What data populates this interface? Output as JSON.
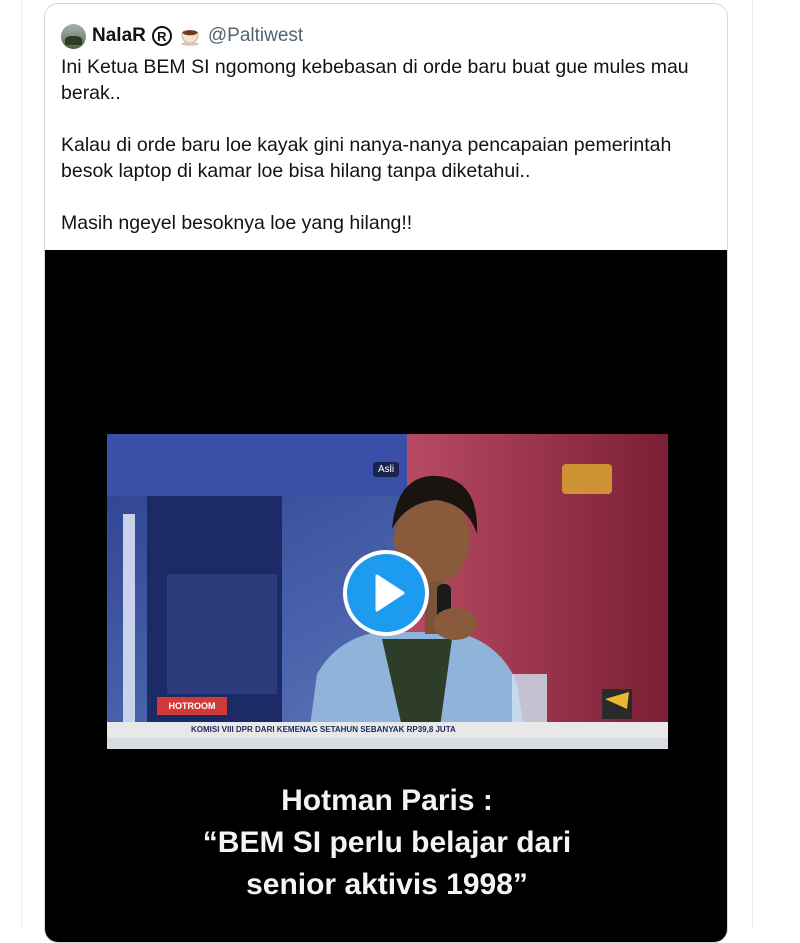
{
  "tweet": {
    "display_name": "NalaR",
    "badge": "R",
    "emoji_icon": "coffee-cup-icon",
    "handle": "@Paltiwest",
    "paragraphs": [
      "Ini Ketua BEM SI ngomong kebebasan di orde baru buat gue mules mau berak..",
      "Kalau di orde baru loe kayak gini nanya-nanya pencapaian pemerintah besok laptop di kamar loe bisa hilang tanpa diketahui..",
      "Masih ngeyel besoknya loe yang hilang!!"
    ]
  },
  "video": {
    "corner_tag": "Asli",
    "show_logo": "HOTROOM",
    "ticker_text": "KOMISI VIII DPR DARI KEMENAG SETAHUN SEBANYAK RP39,8 JUTA",
    "caption_lines": [
      "Hotman Paris :",
      "“BEM SI perlu belajar dari",
      "senior aktivis 1998”"
    ],
    "play_icon": "play-icon",
    "colors": {
      "play_button": "#1d9bf0",
      "background": "#000000",
      "caption": "#f4f4f4"
    }
  }
}
